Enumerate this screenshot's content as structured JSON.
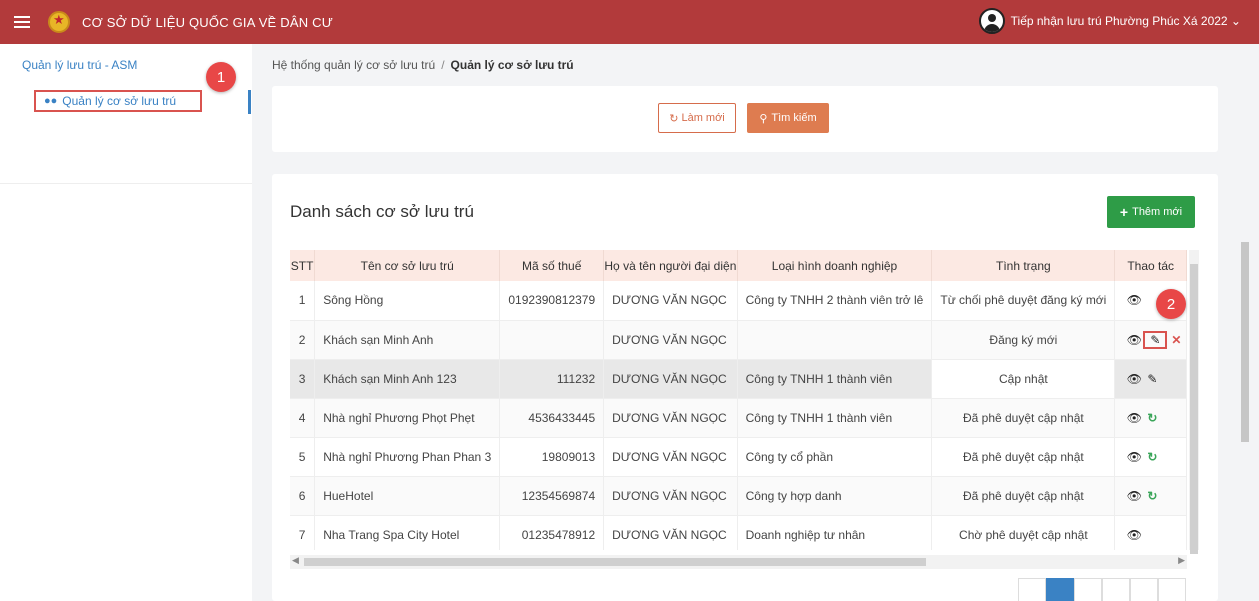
{
  "header": {
    "title": "CƠ SỞ DỮ LIỆU QUỐC GIA VỀ DÂN CƯ",
    "user": "Tiếp nhận lưu trú Phường Phúc Xá 2022 ⌄"
  },
  "sidebar": {
    "group": "Quản lý lưu trú - ASM",
    "items": [
      {
        "label": "Quản lý cơ sở lưu trú"
      }
    ]
  },
  "badges": {
    "one": "1",
    "two": "2"
  },
  "breadcrumb": {
    "parent": "Hệ thống quản lý cơ sở lưu trú",
    "separator": "/",
    "current": "Quản lý cơ sở lưu trú"
  },
  "search": {
    "reset_label": "Làm mới",
    "search_label": "Tìm kiếm"
  },
  "list": {
    "title": "Danh sách cơ sở lưu trú",
    "add_label": "Thêm mới",
    "columns": [
      "STT",
      "Tên cơ sở lưu trú",
      "Mã số thuế",
      "Họ và tên người đại diện",
      "Loại hình doanh nghiệp",
      "Tình trạng",
      "Thao tác"
    ],
    "rows": [
      {
        "stt": "1",
        "name": "Sông Hồng",
        "tax": "0192390812379",
        "rep": "DƯƠNG VĂN NGỌC",
        "type": "Công ty TNHH 2 thành viên trở lê",
        "status": "Từ chối phê duyệt đăng ký mới",
        "actions": [
          "view"
        ]
      },
      {
        "stt": "2",
        "name": "Khách sạn Minh Anh",
        "tax": "",
        "rep": "DƯƠNG VĂN NGỌC",
        "type": "",
        "status": "Đăng ký mới",
        "actions": [
          "view",
          "edit",
          "delete"
        ]
      },
      {
        "stt": "3",
        "name": "Khách sạn Minh Anh 123",
        "tax": "111232",
        "rep": "DƯƠNG VĂN NGỌC",
        "type": "Công ty TNHH 1 thành viên",
        "status": "Cập nhật",
        "actions": [
          "view",
          "edit"
        ]
      },
      {
        "stt": "4",
        "name": "Nhà nghỉ Phương Phọt Phẹt",
        "tax": "4536433445",
        "rep": "DƯƠNG VĂN NGỌC",
        "type": "Công ty TNHH 1 thành viên",
        "status": "Đã phê duyệt cập nhật",
        "actions": [
          "view",
          "sync"
        ]
      },
      {
        "stt": "5",
        "name": "Nhà nghỉ Phương Phan Phan 3",
        "tax": "19809013",
        "rep": "DƯƠNG VĂN NGỌC",
        "type": "Công ty cổ phần",
        "status": "Đã phê duyệt cập nhật",
        "actions": [
          "view",
          "sync"
        ]
      },
      {
        "stt": "6",
        "name": "HueHotel",
        "tax": "12354569874",
        "rep": "DƯƠNG VĂN NGỌC",
        "type": "Công ty hợp danh",
        "status": "Đã phê duyệt cập nhật",
        "actions": [
          "view",
          "sync"
        ]
      },
      {
        "stt": "7",
        "name": "Nha Trang Spa City Hotel",
        "tax": "01235478912",
        "rep": "DƯƠNG VĂN NGỌC",
        "type": "Doanh nghiệp tư nhân",
        "status": "Chờ phê duyệt cập nhật",
        "actions": [
          "view"
        ]
      }
    ]
  },
  "icons": {
    "view": "eye-icon",
    "edit": "edit-icon",
    "delete": "delete-icon",
    "sync": "sync-icon"
  },
  "colors": {
    "header_bg": "#b23a3b",
    "accent": "#de7c50",
    "add_button": "#2e9c47",
    "link": "#3a82c4",
    "highlight": "#d9534f"
  }
}
